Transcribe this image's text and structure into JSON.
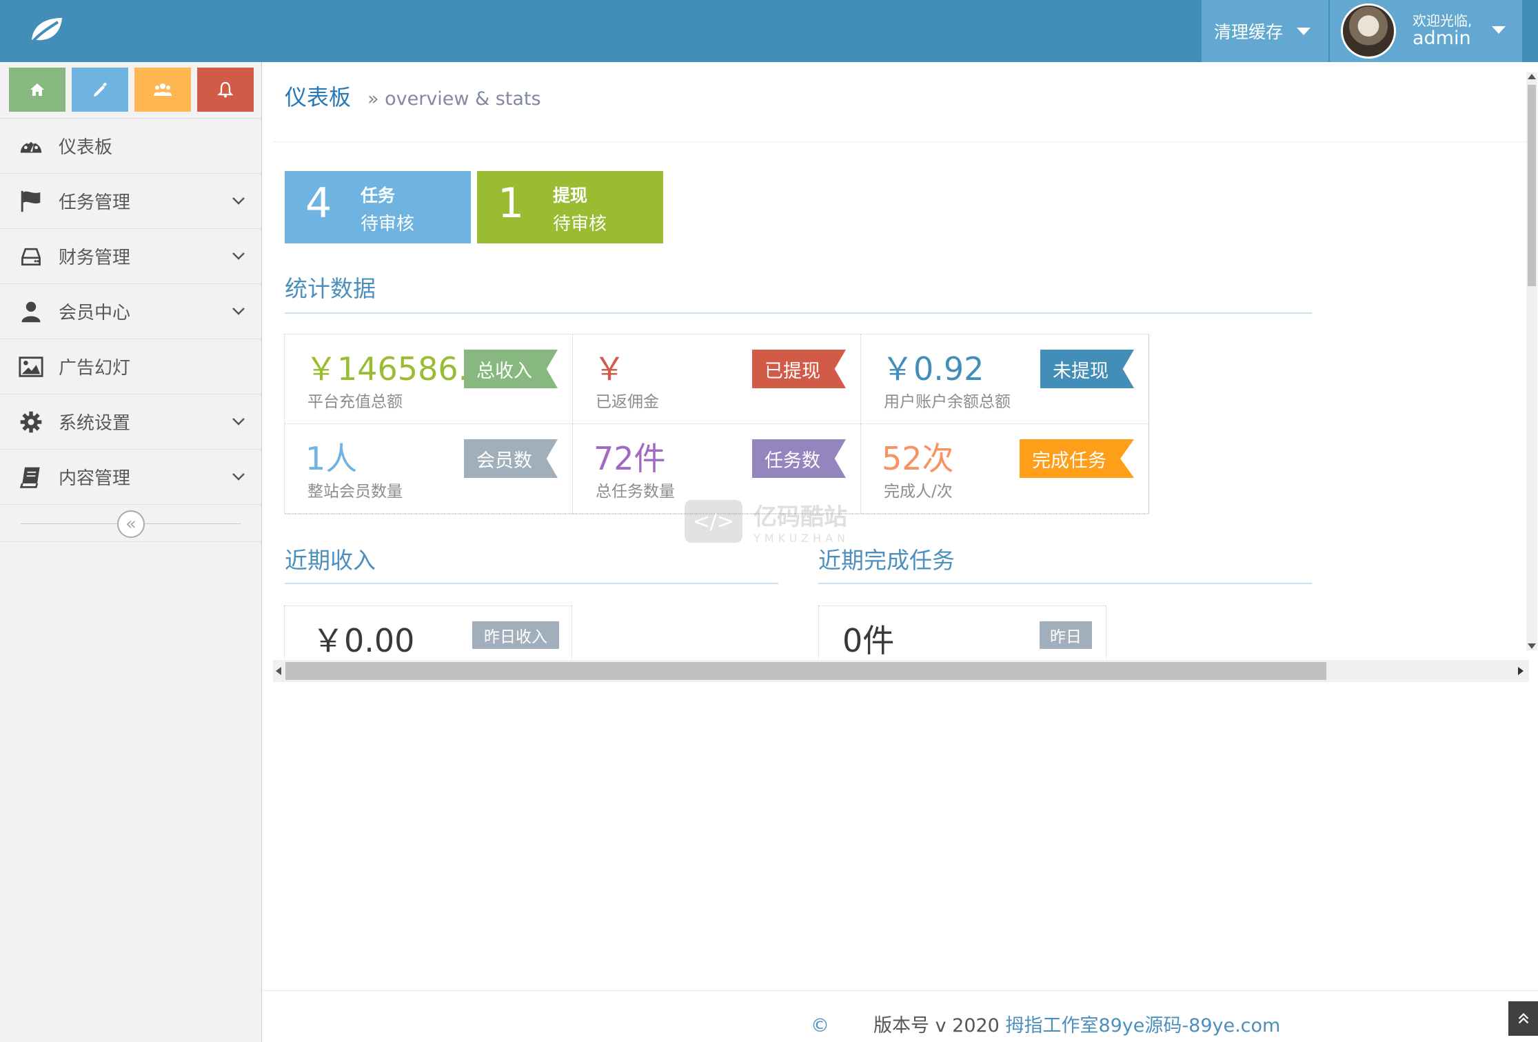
{
  "navbar": {
    "clear_cache": "清理缓存",
    "welcome": "欢迎光临,",
    "username": "admin"
  },
  "sidebar": {
    "items": [
      {
        "label": "仪表板"
      },
      {
        "label": "任务管理"
      },
      {
        "label": "财务管理"
      },
      {
        "label": "会员中心"
      },
      {
        "label": "广告幻灯"
      },
      {
        "label": "系统设置"
      },
      {
        "label": "内容管理"
      }
    ],
    "collapse_glyph": "«"
  },
  "page": {
    "title": "仪表板",
    "subtitle": "» overview & stats"
  },
  "infoboxes": [
    {
      "number": "4",
      "title": "任务",
      "status": "待审核",
      "color": "#6fb3e0"
    },
    {
      "number": "1",
      "title": "提现",
      "status": "待审核",
      "color": "#9abc32"
    }
  ],
  "stats": {
    "section_title": "统计数据",
    "items": [
      {
        "value": "￥146586.00",
        "label": "平台充值总额",
        "badge": "总收入",
        "value_color": "#9abc32",
        "badge_color": "#87b87f"
      },
      {
        "value": "￥",
        "label": "已返佣金",
        "badge": "已提现",
        "value_color": "#d15b47",
        "badge_color": "#d15b47"
      },
      {
        "value": "￥0.92",
        "label": "用户账户余额总额",
        "badge": "未提现",
        "value_color": "#438eb9",
        "badge_color": "#438eb9"
      },
      {
        "value": "1人",
        "label": "整站会员数量",
        "badge": "会员数",
        "value_color": "#6fb3e0",
        "badge_color": "#a0afbb"
      },
      {
        "value": "72件",
        "label": "总任务数量",
        "badge": "任务数",
        "value_color": "#a069c3",
        "badge_color": "#9585bf"
      },
      {
        "value": "52次",
        "label": "完成人/次",
        "badge": "完成任务",
        "value_color": "#f79263",
        "badge_color": "#ff9e18"
      }
    ]
  },
  "recent_income": {
    "title": "近期收入",
    "value": "￥0.00",
    "tag": "昨日收入"
  },
  "recent_tasks": {
    "title": "近期完成任务",
    "value": "0件",
    "tag": "昨日"
  },
  "watermark": {
    "glyph": "</>",
    "name": "亿码酷站",
    "sub": "YMKUZHAN"
  },
  "footer": {
    "copyright": "©",
    "version": "版本号 v 2020 ",
    "link_text": "拇指工作室89ye源码-89ye.com"
  }
}
